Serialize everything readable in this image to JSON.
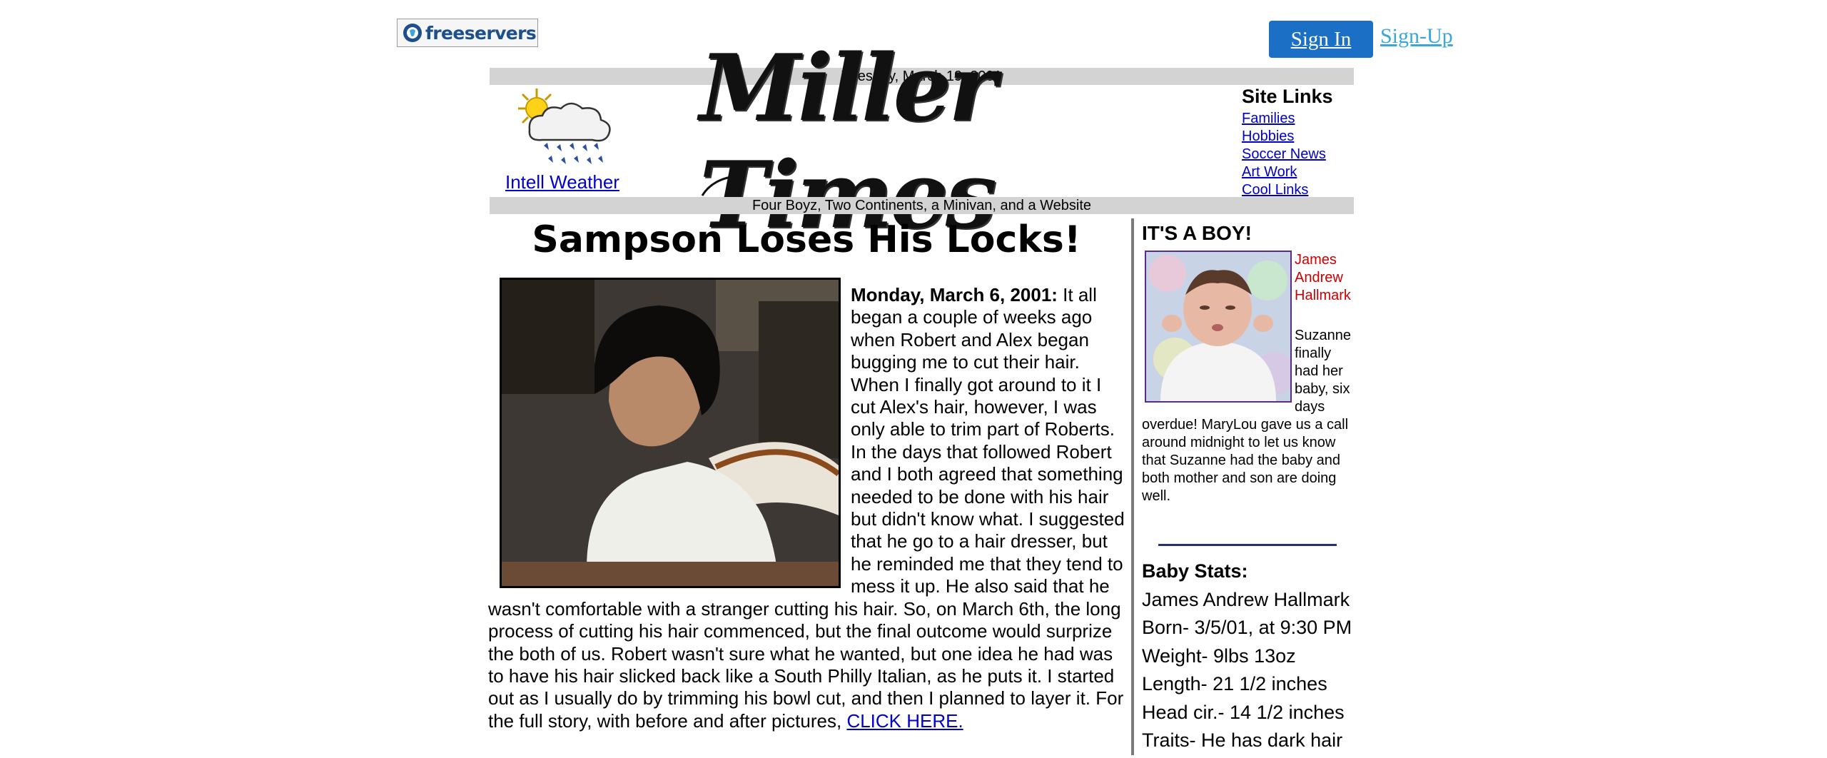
{
  "host_bar": {
    "logo_text": "freeservers",
    "sign_in": "Sign In",
    "sign_up": "Sign-Up"
  },
  "masthead": {
    "date": "Tuesday, March 19, 2001",
    "weather_link": "Intell Weather",
    "title": "Miller Times",
    "tagline": "Four Boyz, Two Continents, a Minivan, and a Website"
  },
  "site_links": {
    "heading": "Site Links",
    "items": [
      "Families",
      "Hobbies",
      "Soccer News",
      "Art Work",
      "Cool Links"
    ]
  },
  "article": {
    "headline": "Sampson Loses His Locks!",
    "dateline": "Monday, March 6, 2001:",
    "body": " It all began a couple of weeks ago when Robert and Alex began bugging me to cut their hair. When I finally got around to it I cut Alex's hair, however, I was only able to trim part of Roberts. In the days that followed Robert and I both agreed that something needed to be done with his hair but didn't know what. I suggested that he go to a hair dresser, but he reminded me that they tend to mess it up. He also said that he wasn't comfortable with a stranger cutting his hair. So, on March 6th, the long process of cutting his hair commenced, but the final outcome would surprize the both of us. Robert wasn't sure what he wanted, but one idea he had was to have his hair slicked back like a South Philly Italian, as he puts it. I started out as I usually do by trimming his bowl cut, and then I planned to layer it. For the full story, with before and after pictures, ",
    "link": "CLICK HERE."
  },
  "sidebar": {
    "heading": "IT'S A BOY!",
    "baby_name": "James Andrew Hallmark",
    "story": "Suzanne finally had her baby, six days overdue! MaryLou gave us a call around midnight to let us know that Suzanne had the baby and both mother and son are doing well.",
    "stats_heading": "Baby Stats:",
    "stats": [
      "James Andrew Hallmark",
      "Born- 3/5/01, at 9:30 PM",
      "Weight- 9lbs 13oz",
      "Length- 21 1/2 inches",
      "Head cir.- 14 1/2 inches",
      "Traits- He has dark hair"
    ]
  },
  "colors": {
    "sign_in_bg": "#1b70c6",
    "sign_up": "#3aa6d9",
    "link": "#0000cc",
    "strip_grey": "#d3d3d3",
    "baby_name": "#d10000"
  }
}
